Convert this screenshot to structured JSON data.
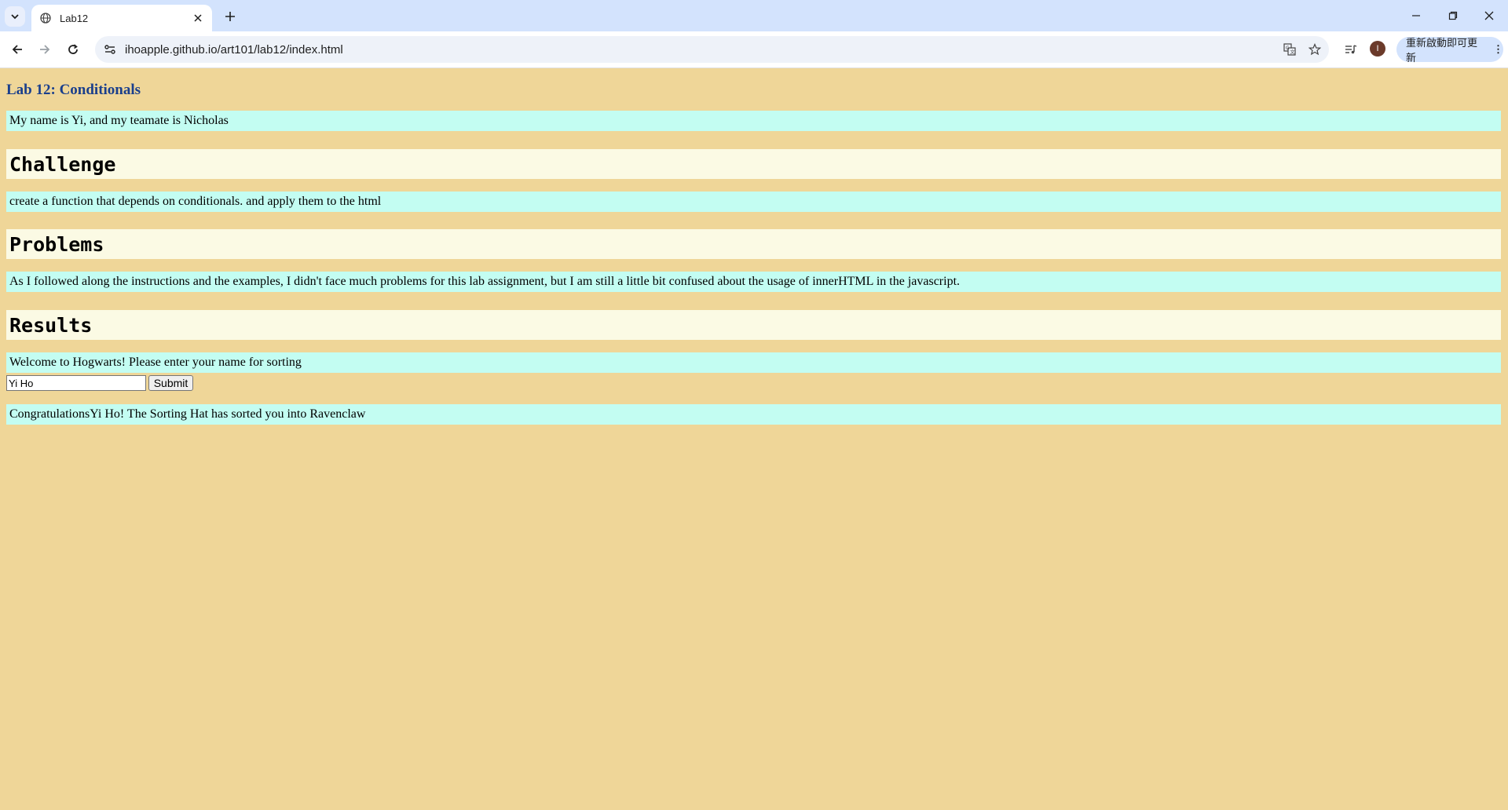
{
  "browser": {
    "tab_title": "Lab12",
    "url": "ihoapple.github.io/art101/lab12/index.html",
    "update_label": "重新啟動即可更新",
    "profile_initial": "I"
  },
  "page": {
    "title": "Lab 12: Conditionals",
    "intro": "My name is Yi, and my teamate is Nicholas",
    "sections": [
      {
        "heading": "Challenge",
        "text": "create a function that depends on conditionals. and apply them to the html"
      },
      {
        "heading": "Problems",
        "text": "As I followed along the instructions and the examples, I didn't face much problems for this lab assignment, but I am still a little bit confused about the usage of innerHTML in the javascript."
      },
      {
        "heading": "Results",
        "text": "Welcome to Hogwarts! Please enter your name for sorting"
      }
    ],
    "input_value": "Yi Ho",
    "submit_label": "Submit",
    "output": "CongratulationsYi Ho! The Sorting Hat has sorted you into Ravenclaw"
  },
  "colors": {
    "page_bg": "#efd698",
    "para_bg": "#c3fdf2",
    "heading_bg": "#fbfae4",
    "title_color": "#1a3f8c"
  }
}
